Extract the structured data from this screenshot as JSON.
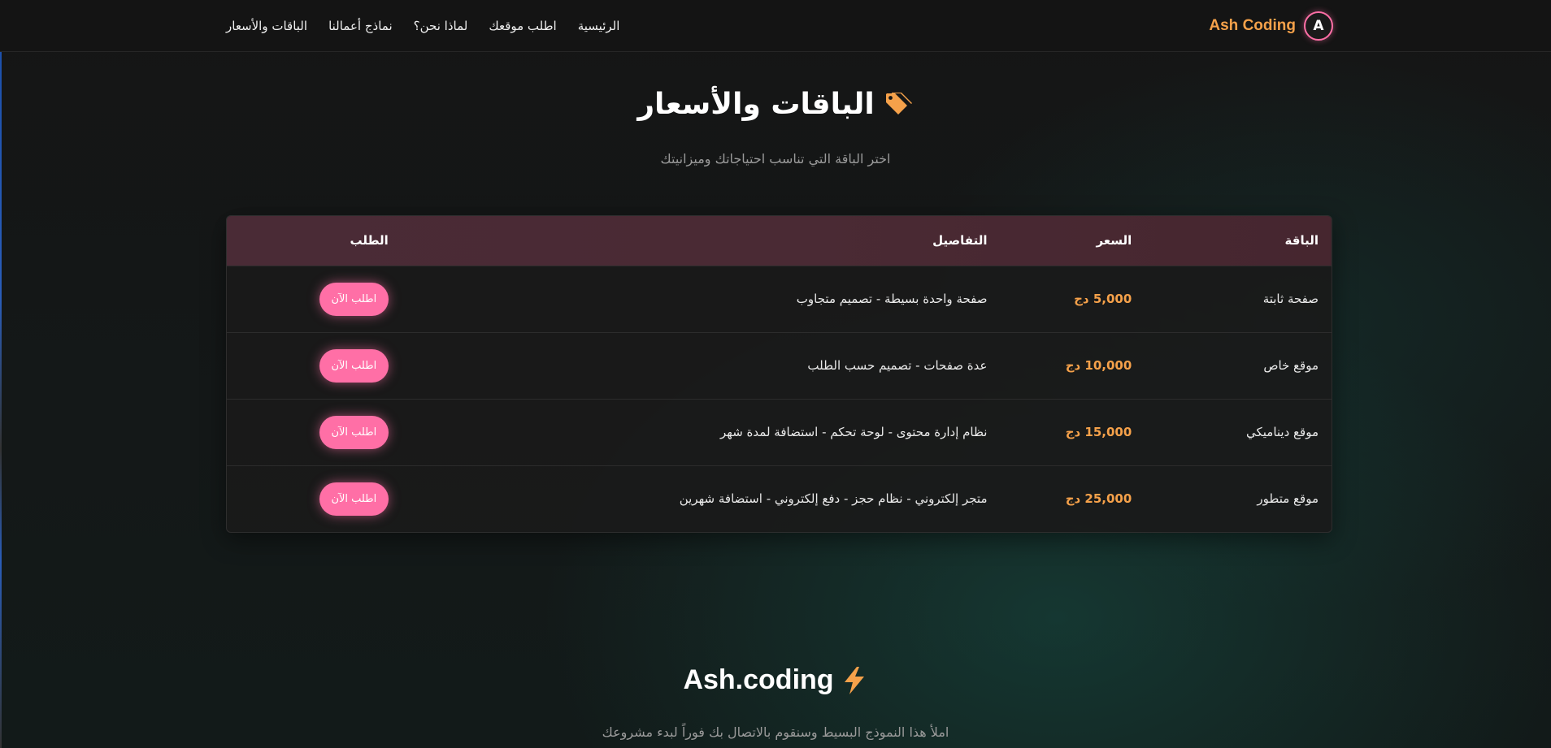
{
  "nav": {
    "brand": {
      "name": "Ash Coding",
      "logo_letter": "A"
    },
    "links": [
      {
        "label": "الرئيسية"
      },
      {
        "label": "اطلب موقعك"
      },
      {
        "label": "لماذا نحن؟"
      },
      {
        "label": "نماذج أعمالنا"
      },
      {
        "label": "الباقات والأسعار"
      }
    ]
  },
  "pricing": {
    "icon": "tag-icon",
    "title": "الباقات والأسعار",
    "subtitle": "اختر الباقة التي تناسب احتياجاتك وميزانيتك",
    "headers": {
      "package": "الباقة",
      "price": "السعر",
      "details": "التفاصيل",
      "order": "الطلب"
    },
    "rows": [
      {
        "package": "صفحة ثابتة",
        "price": "5,000 دج",
        "details": "صفحة واحدة بسيطة - تصميم متجاوب",
        "button": "اطلب الآن"
      },
      {
        "package": "موقع خاص",
        "price": "10,000 دج",
        "details": "عدة صفحات - تصميم حسب الطلب",
        "button": "اطلب الآن"
      },
      {
        "package": "موقع ديناميكي",
        "price": "15,000 دج",
        "details": "نظام إدارة محتوى - لوحة تحكم - استضافة لمدة شهر",
        "button": "اطلب الآن"
      },
      {
        "package": "موقع متطور",
        "price": "25,000 دج",
        "details": "متجر إلكتروني - نظام حجز - دفع إلكتروني - استضافة شهرين",
        "button": "اطلب الآن"
      }
    ]
  },
  "contact": {
    "icon": "lightning-icon",
    "title": "Ash.coding",
    "subtitle": "املأ هذا النموذج البسيط وسنقوم بالاتصال بك فوراً لبدء مشروعك"
  },
  "colors": {
    "accent_orange": "#f5a14a",
    "accent_pink": "#ff6fa6",
    "header_row": "#4a2b36",
    "background": "#141414"
  }
}
